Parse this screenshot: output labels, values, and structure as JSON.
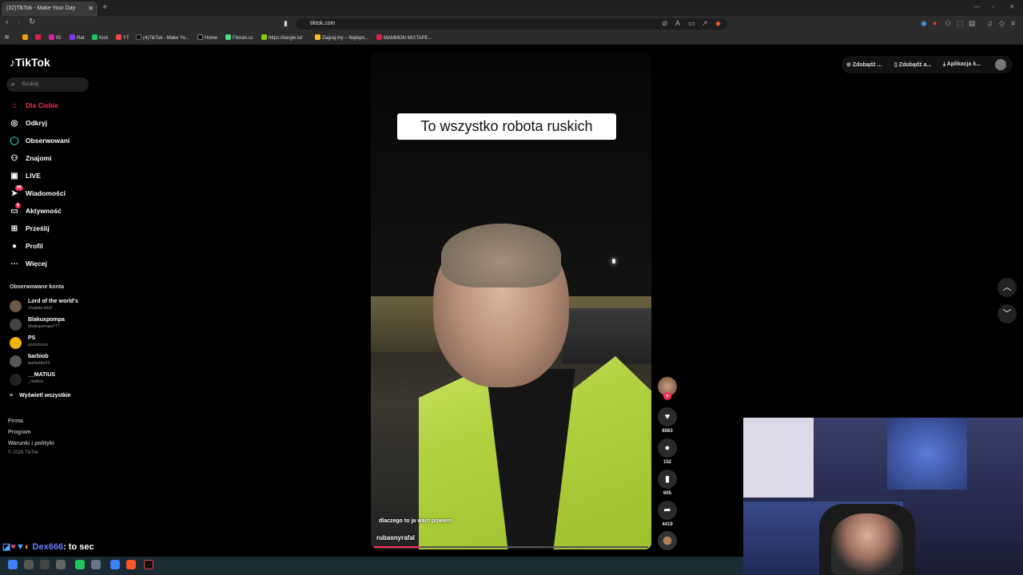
{
  "browser": {
    "tab_title": "(32)TikTok - Make Your Day",
    "url": "tiktok.com",
    "bookmarks": [
      "IG",
      "Rat",
      "Kick",
      "YT",
      "(4)TikTok - Make Yo...",
      "Home",
      "Filman.cc",
      "https://tangle.io/",
      "Zagraj.my – Najleps...",
      "MAMMON MIXTAPE..."
    ]
  },
  "sidebar": {
    "logo": "TikTok",
    "search_placeholder": "Szukaj",
    "nav": [
      {
        "label": "Dla Ciebie",
        "icon": "home-icon"
      },
      {
        "label": "Odkryj",
        "icon": "compass-icon"
      },
      {
        "label": "Obserwowani",
        "icon": "following-icon"
      },
      {
        "label": "Znajomi",
        "icon": "friends-icon"
      },
      {
        "label": "LIVE",
        "icon": "live-icon"
      },
      {
        "label": "Wiadomości",
        "icon": "messages-icon",
        "badge": "99"
      },
      {
        "label": "Aktywność",
        "icon": "activity-icon",
        "badge": "6"
      },
      {
        "label": "Prześlij",
        "icon": "upload-icon"
      },
      {
        "label": "Profil",
        "icon": "profile-icon"
      },
      {
        "label": "Więcej",
        "icon": "more-icon"
      }
    ],
    "followed_title": "Obserwowane konta",
    "accounts": [
      {
        "name": "Lord of the world's",
        "handle": "chujwie.kto2"
      },
      {
        "name": "Blakuxpompa",
        "handle": "blejkspompa777"
      },
      {
        "name": "PS",
        "handle": "pszszszsz"
      },
      {
        "name": "barbiob",
        "handle": "barbeble22"
      },
      {
        "name": "__MATIUS",
        "handle": "_matius"
      }
    ],
    "show_all": "Wyświetl wszystkie",
    "footer": [
      "Firma",
      "Program",
      "Warunki i polityki"
    ],
    "copyright": "© 2026 TikTok"
  },
  "header": {
    "btn1": "Zdobądź ...",
    "btn2": "Zdobądź a...",
    "btn3": "Aplikacja k..."
  },
  "video": {
    "caption": "To wszystko robota ruskich",
    "subtitle": "dlaczego to ja wam powiem",
    "author": "rubasnyrafal",
    "progress": 0.17,
    "likes": "6563",
    "comments": "152",
    "saves": "605",
    "shares": "4419"
  },
  "chat": {
    "user": "Dex666",
    "message": ": to sec"
  },
  "colors": {
    "accent": "#fe2c55",
    "background": "#000000"
  }
}
